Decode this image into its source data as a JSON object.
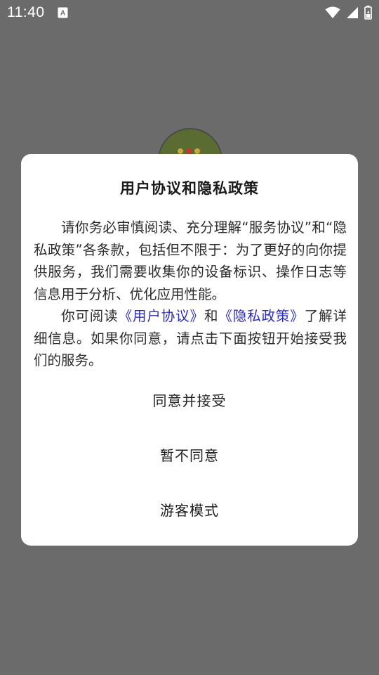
{
  "status_bar": {
    "time": "11:40",
    "icons": [
      "text-icon",
      "wifi-icon",
      "signal-icon",
      "battery-icon"
    ]
  },
  "dialog": {
    "title": "用户协议和隐私政策",
    "paragraph1": "请你务必审慎阅读、充分理解“服务协议”和“隐私政策”各条款，包括但不限于：为了更好的向你提供服务，我们需要收集你的设备标识、操作日志等信息用于分析、优化应用性能。",
    "paragraph2_prefix": "你可阅读",
    "user_agreement_link": "《用户协议》",
    "paragraph2_and": "和",
    "privacy_policy_link": "《隐私政策》",
    "paragraph2_suffix": "了解详细信息。如果你同意，请点击下面按钮开始接受我们的服务。",
    "accept_label": "同意并接受",
    "decline_label": "暂不同意",
    "guest_label": "游客模式"
  },
  "colors": {
    "overlay": "#6b6b6b",
    "dialog_bg": "#ffffff",
    "link": "#2d2db8",
    "logo_green": "#5a6c32"
  }
}
